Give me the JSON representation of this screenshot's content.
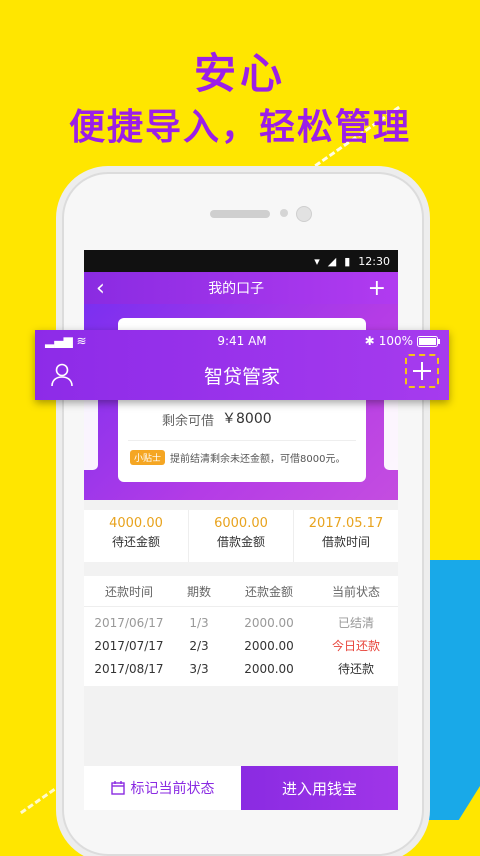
{
  "hero": {
    "line1": "安心",
    "line2": "便捷导入，轻松管理"
  },
  "android_status": {
    "time": "12:30"
  },
  "app_nav": {
    "back": "‹",
    "title": "我的口子",
    "add": "+"
  },
  "card": {
    "remain_label": "剩余可借",
    "remain_value": "￥8000",
    "tip_tag": "小贴士",
    "tip_text": "提前结清剩余未还金额，可借8000元。"
  },
  "stats": [
    {
      "value": "4000.00",
      "label": "待还金额"
    },
    {
      "value": "6000.00",
      "label": "借款金额"
    },
    {
      "value": "2017.05.17",
      "label": "借款时间"
    }
  ],
  "table": {
    "headers": [
      "还款时间",
      "期数",
      "还款金额",
      "当前状态"
    ],
    "rows": [
      {
        "date": "2017/06/17",
        "period": "1/3",
        "amount": "2000.00",
        "status": "已结清"
      },
      {
        "date": "2017/07/17",
        "period": "2/3",
        "amount": "2000.00",
        "status": "今日还款"
      },
      {
        "date": "2017/08/17",
        "period": "3/3",
        "amount": "2000.00",
        "status": "待还款"
      }
    ]
  },
  "bottom": {
    "mark_label": "标记当前状态",
    "enter_label": "进入用钱宝"
  },
  "ios_bar": {
    "time": "9:41 AM",
    "battery": "100%",
    "title": "智贷管家"
  },
  "colors": {
    "purple": "#8A2BE2",
    "yellow": "#FFE600",
    "orange": "#E8A31E",
    "red": "#E8453C",
    "blue": "#19A9E8"
  }
}
